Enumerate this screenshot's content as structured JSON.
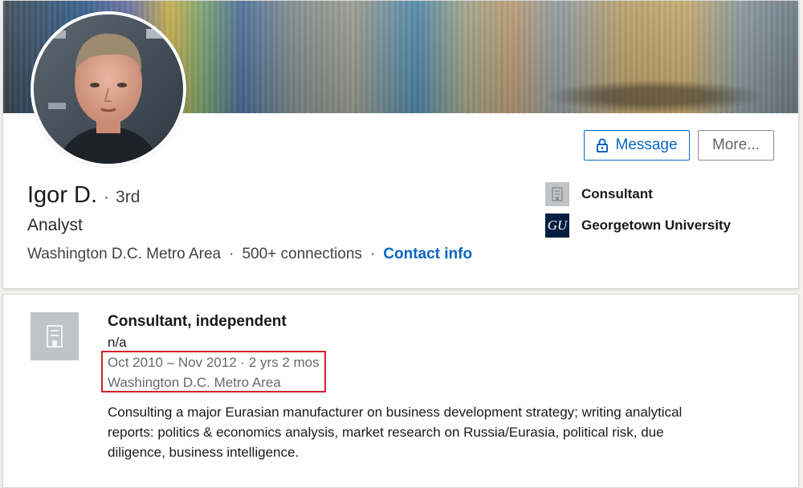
{
  "profile": {
    "name": "Igor D.",
    "degree_sep": "·",
    "degree": "3rd",
    "headline": "Analyst",
    "location": "Washington D.C. Metro Area",
    "connections": "500+ connections",
    "contact_info": "Contact info",
    "dot": "·"
  },
  "actions": {
    "message_label": "Message",
    "more_label": "More..."
  },
  "sidebar": {
    "current_position": "Consultant",
    "education": "Georgetown University",
    "education_logo_text": "GU"
  },
  "experience": {
    "title": "Consultant, independent",
    "company": "n/a",
    "dates": "Oct 2010 – Nov 2012 · 2 yrs 2 mos",
    "location": "Washington D.C. Metro Area",
    "description": "Consulting a major Eurasian manufacturer on business development strategy; writing analytical reports: politics & economics analysis, market research on Russia/Eurasia, political risk, due diligence, business intelligence."
  },
  "icons": {
    "message": "lock-icon",
    "current_position_logo": "building-icon",
    "experience_logo": "building-icon"
  },
  "colors": {
    "accent": "#0a66c2",
    "highlight": "#d0202e",
    "georgetown_navy": "#041e42"
  }
}
